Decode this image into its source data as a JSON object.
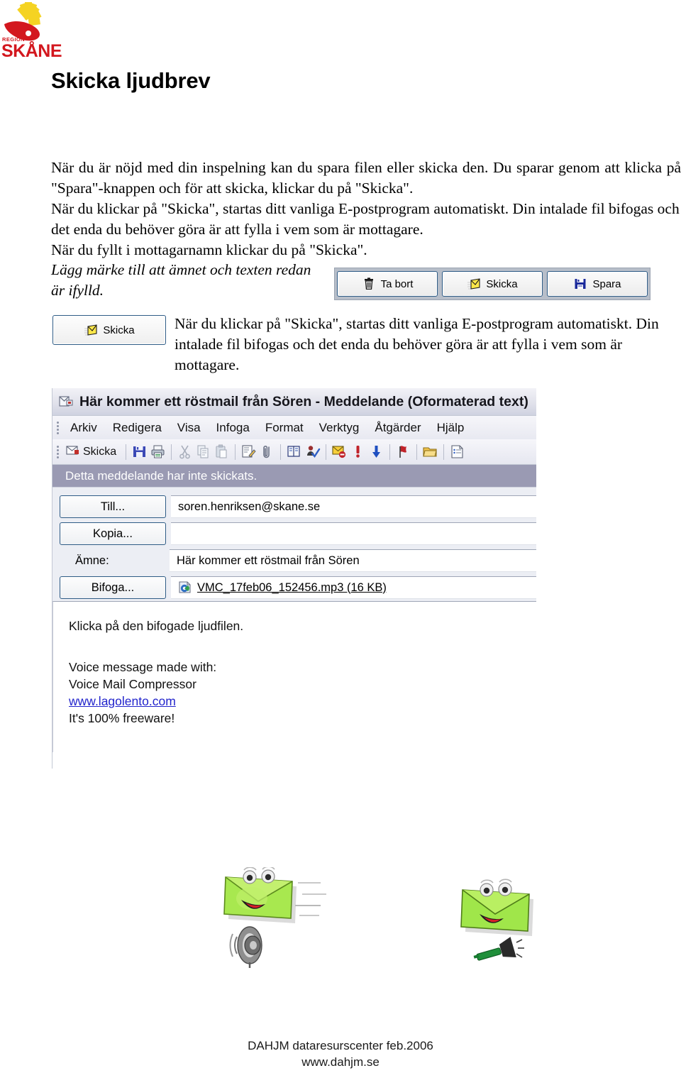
{
  "logo": {
    "region_text": "REGION",
    "name_text": "SKÅNE",
    "colors": {
      "yellow": "#f5d322",
      "red": "#d3171e"
    }
  },
  "page_title": "Skicka ljudbrev",
  "intro": {
    "line1": "När du är nöjd med din inspelning kan du spara filen eller skicka den. Du sparar genom att klicka på \"Spara\"-knappen och för att skicka, klickar du på \"Skicka\".",
    "line2": "När du klickar på \"Skicka\", startas ditt vanliga E-postprogram automatiskt. Din intalade fil bifogas och det enda du behöver göra är att fylla i vem som är mottagare.",
    "line3": "När du fyllt i mottagarnamn klickar du på \"Skicka\"."
  },
  "note_italic": "Lägg märke till att ämnet och texten redan är ifylld.",
  "recorder_toolbar": {
    "buttons": [
      {
        "label": "Ta bort",
        "icon": "trash-icon"
      },
      {
        "label": "Skicka",
        "icon": "send-envelope-icon"
      },
      {
        "label": "Spara",
        "icon": "floppy-save-icon"
      }
    ]
  },
  "solo_button": {
    "label": "Skicka",
    "icon": "send-envelope-icon"
  },
  "after_button_text": "När du klickar på \"Skicka\", startas ditt vanliga E-postprogram automatiskt. Din intalade fil bifogas och det enda du behöver göra är att fylla i vem som är mottagare.",
  "mail_window": {
    "title": "Här kommer ett röstmail från Sören - Meddelande (Oformaterad text)",
    "title_icon": "message-window-icon",
    "menu": [
      {
        "label": "Arkiv",
        "accel": "A"
      },
      {
        "label": "Redigera",
        "accel": "R"
      },
      {
        "label": "Visa",
        "accel": "V"
      },
      {
        "label": "Infoga",
        "accel": "I"
      },
      {
        "label": "Format",
        "accel": "t"
      },
      {
        "label": "Verktyg",
        "accel": "y"
      },
      {
        "label": "Åtgärder",
        "accel": "Å"
      },
      {
        "label": "Hjälp",
        "accel": "H"
      }
    ],
    "toolbar": {
      "send_label": "Skicka",
      "icons": [
        "save-icon",
        "print-icon",
        "cut-icon",
        "copy-icon",
        "paste-icon",
        "format-painter-icon",
        "attach-paperclip-icon",
        "address-book-icon",
        "check-names-icon",
        "flag-message-icon",
        "high-importance-icon",
        "low-importance-icon",
        "red-flag-icon",
        "open-folder-icon",
        "options-icon"
      ]
    },
    "info_bar": "Detta meddelande har inte skickats.",
    "fields": [
      {
        "type": "button",
        "label": "Till...",
        "accel": "l",
        "value": "soren.henriksen@skane.se"
      },
      {
        "type": "button",
        "label": "Kopia...",
        "accel": "p",
        "value": ""
      },
      {
        "type": "label",
        "label": "Ämne:",
        "accel": "m",
        "value": "Här kommer ett röstmail från Sören"
      },
      {
        "type": "button",
        "label": "Bifoga...",
        "accel": "g",
        "value": "VMC_17feb06_152456.mp3 (16 KB)",
        "attachment_icon": "mp3-media-icon"
      }
    ],
    "body": {
      "line1": "Klicka på den bifogade ljudfilen.",
      "line2": "Voice message made with:",
      "line3": "Voice Mail Compressor",
      "link": "www.lagolento.com",
      "line4": "It's 100% freeware!"
    }
  },
  "cliparts": [
    {
      "name": "envelope-with-speaker-clipart"
    },
    {
      "name": "envelope-with-trumpet-clipart"
    }
  ],
  "footer": {
    "line1": "DAHJM dataresurscenter feb.2006",
    "line2": "www.dahjm.se"
  }
}
